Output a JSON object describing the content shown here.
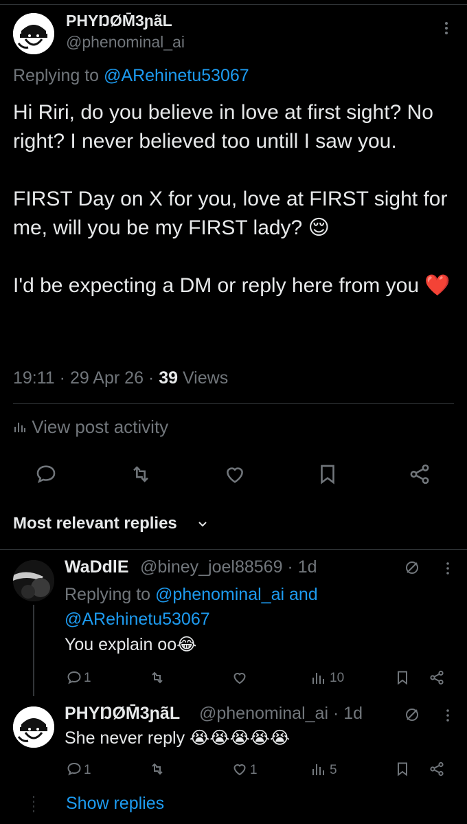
{
  "post": {
    "author_name": "PHYŊØM̄3ɲãL",
    "author_handle": "@phenominal_ai",
    "replying_prefix": "Replying to ",
    "replying_to": "@ARehinetu53067",
    "paragraphs": [
      "Hi Riri, do you believe in love at first sight? No right? I never believed too untill I saw you.",
      "FIRST Day on X for you, love at FIRST sight for me, will you be my FIRST lady? 😌",
      "I'd be expecting a DM or reply here from you ❤️"
    ],
    "time": "19:11",
    "date": "29 Apr 26",
    "views_count": "39",
    "views_label": "Views",
    "activity_label": "View post activity"
  },
  "replies_header": {
    "sort_label": "Most relevant replies"
  },
  "replies": [
    {
      "name": "WaDdlE",
      "handle": "@biney_joel88569",
      "age": "1d",
      "replying_prefix": "Replying to ",
      "replying_to_1": "@phenominal_ai",
      "replying_and": " and",
      "replying_to_2": "@ARehinetu53067",
      "text": "You explain oo😂",
      "reply_count": "1",
      "like_count": "",
      "views_count": "10"
    },
    {
      "name": "PHYŊØM̄3ɲãL",
      "handle": "@phenominal_ai",
      "age": "1d",
      "text": "She never reply 😭😭😭😭😭",
      "reply_count": "1",
      "like_count": "1",
      "views_count": "5"
    }
  ],
  "show_replies_label": "Show replies",
  "colors": {
    "background": "#000000",
    "text": "#e7e9ea",
    "muted": "#71767b",
    "link": "#1d9bf0",
    "divider": "#2f3336"
  }
}
